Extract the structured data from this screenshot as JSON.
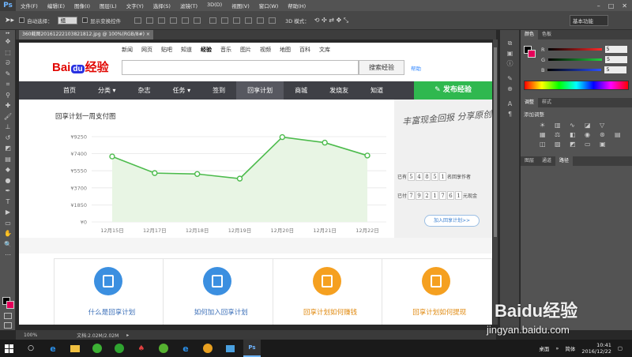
{
  "app": {
    "logo": "Ps",
    "menu": [
      "文件(F)",
      "编辑(E)",
      "图像(I)",
      "图层(L)",
      "文字(Y)",
      "选择(S)",
      "滤镜(T)",
      "3D(D)",
      "视图(V)",
      "窗口(W)",
      "帮助(H)"
    ],
    "window_controls": [
      "–",
      "□",
      "✕"
    ]
  },
  "options": {
    "auto_select": "自动选择：",
    "auto_select_value": "组",
    "show_transform": "显示变换控件",
    "mode_3d": "3D 模式：",
    "workspace": "基本功能"
  },
  "document": {
    "tab_title": "360截图20161222103821812.jpg @ 100%(RGB/8#)",
    "zoom": "100%",
    "doc_size": "文档:2.02M/2.02M"
  },
  "panels": {
    "color_tabs": [
      "颜色",
      "色板"
    ],
    "channels": [
      {
        "label": "R",
        "value": "5",
        "color": "#ff2a2a"
      },
      {
        "label": "G",
        "value": "5",
        "color": "#20d040"
      },
      {
        "label": "B",
        "value": "5",
        "color": "#2a50ff"
      }
    ],
    "adjust_tabs": [
      "调整",
      "样式"
    ],
    "adjust_title": "添加调整",
    "layer_tabs": [
      "图层",
      "通道",
      "路径"
    ]
  },
  "page": {
    "top_nav": [
      "新闻",
      "网页",
      "贴吧",
      "知道",
      "经验",
      "音乐",
      "图片",
      "视频",
      "地图",
      "百科",
      "文库"
    ],
    "active_top_nav": "经验",
    "logo_text": "Bai",
    "logo_badge": "du",
    "logo_suffix": "经验",
    "search_button": "搜索经验",
    "help": "帮助",
    "nav": [
      "首页",
      "分类 ▾",
      "杂志",
      "任务 ▾",
      "签到",
      "回享计划",
      "商城",
      "发烧友",
      "知道"
    ],
    "active_nav": "回享计划",
    "publish": "发布经验",
    "ad_slogan": "丰富现金回报 分享原创经验",
    "counter1": {
      "prefix": "已有",
      "digits": [
        "5",
        "4",
        "8",
        "5",
        "1"
      ],
      "suffix": "名回享作者"
    },
    "counter2": {
      "prefix": "已付",
      "digits": [
        "7",
        "9",
        "2",
        "1",
        "7",
        "6",
        "1"
      ],
      "suffix": "元现金"
    },
    "join_button": "加入回享计划>>",
    "features": [
      {
        "label": "什么是回享计划",
        "icon": "book-icon",
        "color": "#3b8fe0",
        "label_color": "#3b6fb8"
      },
      {
        "label": "如何加入回享计划",
        "icon": "pen-icon",
        "color": "#3b8fe0",
        "label_color": "#3b6fb8"
      },
      {
        "label": "回享计划如何赚钱",
        "icon": "money-bag-icon",
        "color": "#f5a020",
        "label_color": "#e08a10"
      },
      {
        "label": "回享计划如何提现",
        "icon": "cash-icon",
        "color": "#f5a020",
        "label_color": "#e08a10"
      }
    ]
  },
  "chart_data": {
    "type": "area",
    "title": "回享计划一周支付图",
    "categories": [
      "12月15日",
      "12月17日",
      "12月18日",
      "12月19日",
      "12月20日",
      "12月21日",
      "12月22日"
    ],
    "values": [
      7100,
      5300,
      5200,
      4700,
      9200,
      8600,
      7200
    ],
    "yticks": [
      "¥9250",
      "¥7400",
      "¥5550",
      "¥3700",
      "¥1850",
      "¥0"
    ],
    "ylim": [
      0,
      9250
    ],
    "color": "#4cbb4c",
    "fill": "#e8f5e4"
  },
  "taskbar": {
    "desktop": "桌面",
    "ime": "简体",
    "time": "10:41",
    "date": "2016/12/22"
  },
  "watermark": {
    "brand": "Baidu经验",
    "url": "jingyan.baidu.com"
  }
}
